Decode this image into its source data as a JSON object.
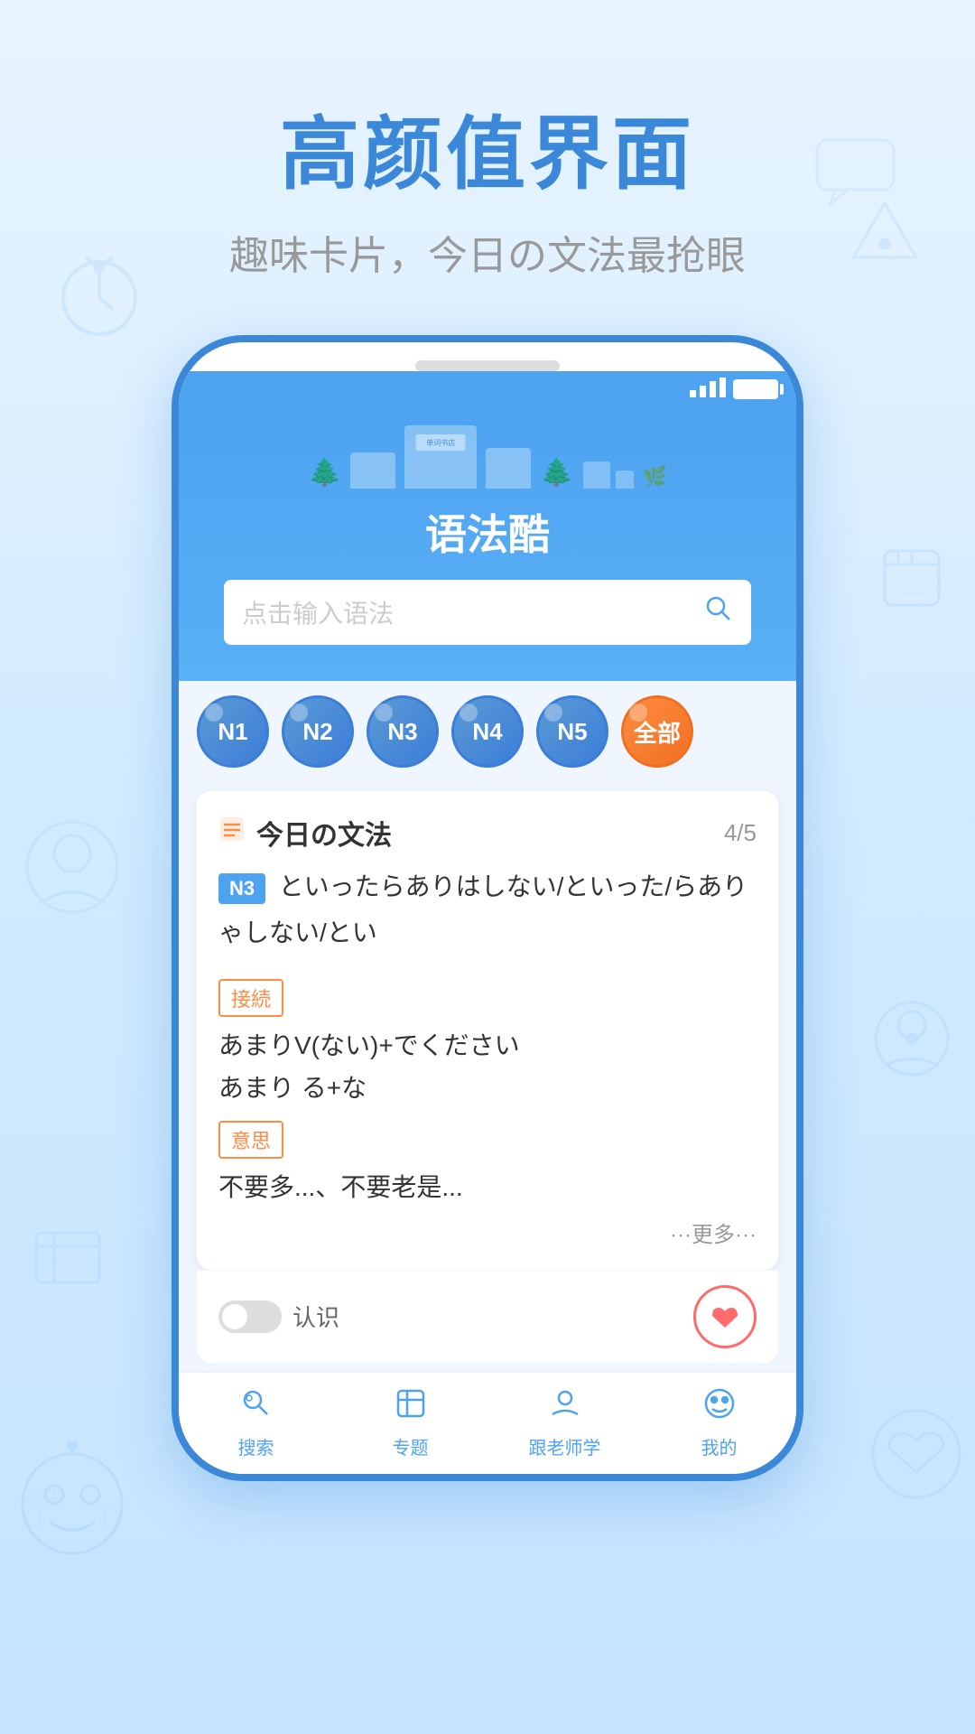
{
  "page": {
    "background": "#d0eaff"
  },
  "headline": {
    "main_title": "高颜值界面",
    "sub_title": "趣味卡片，今日の文法最抢眼"
  },
  "app": {
    "title": "语法酷",
    "search_placeholder": "点击输入语法",
    "level_buttons": [
      {
        "label": "N1",
        "active": false
      },
      {
        "label": "N2",
        "active": false
      },
      {
        "label": "N3",
        "active": false
      },
      {
        "label": "N4",
        "active": false
      },
      {
        "label": "N5",
        "active": false
      },
      {
        "label": "全部",
        "active": true
      }
    ],
    "card": {
      "title": "今日の文法",
      "progress": "4/5",
      "grammar_level": "N3",
      "grammar_text": "といったらありはしない/といった/らありゃしない/とい",
      "section_juzoku": "接続",
      "juzoku_content": "あまりV(ない)+でください\nあまり る+な",
      "section_yisi": "意思",
      "yisi_content": "不要多...、不要老是...",
      "more_text": "···更多···"
    },
    "actions": {
      "toggle_label": "认识",
      "heart_icon": "♥"
    },
    "nav": [
      {
        "label": "搜索",
        "icon": "🔍"
      },
      {
        "label": "专题",
        "icon": "📋"
      },
      {
        "label": "跟老师学",
        "icon": "👤"
      },
      {
        "label": "我的",
        "icon": "😊"
      }
    ]
  },
  "icons": {
    "search": "○",
    "signal": "▲▲▲",
    "battery": "□"
  }
}
